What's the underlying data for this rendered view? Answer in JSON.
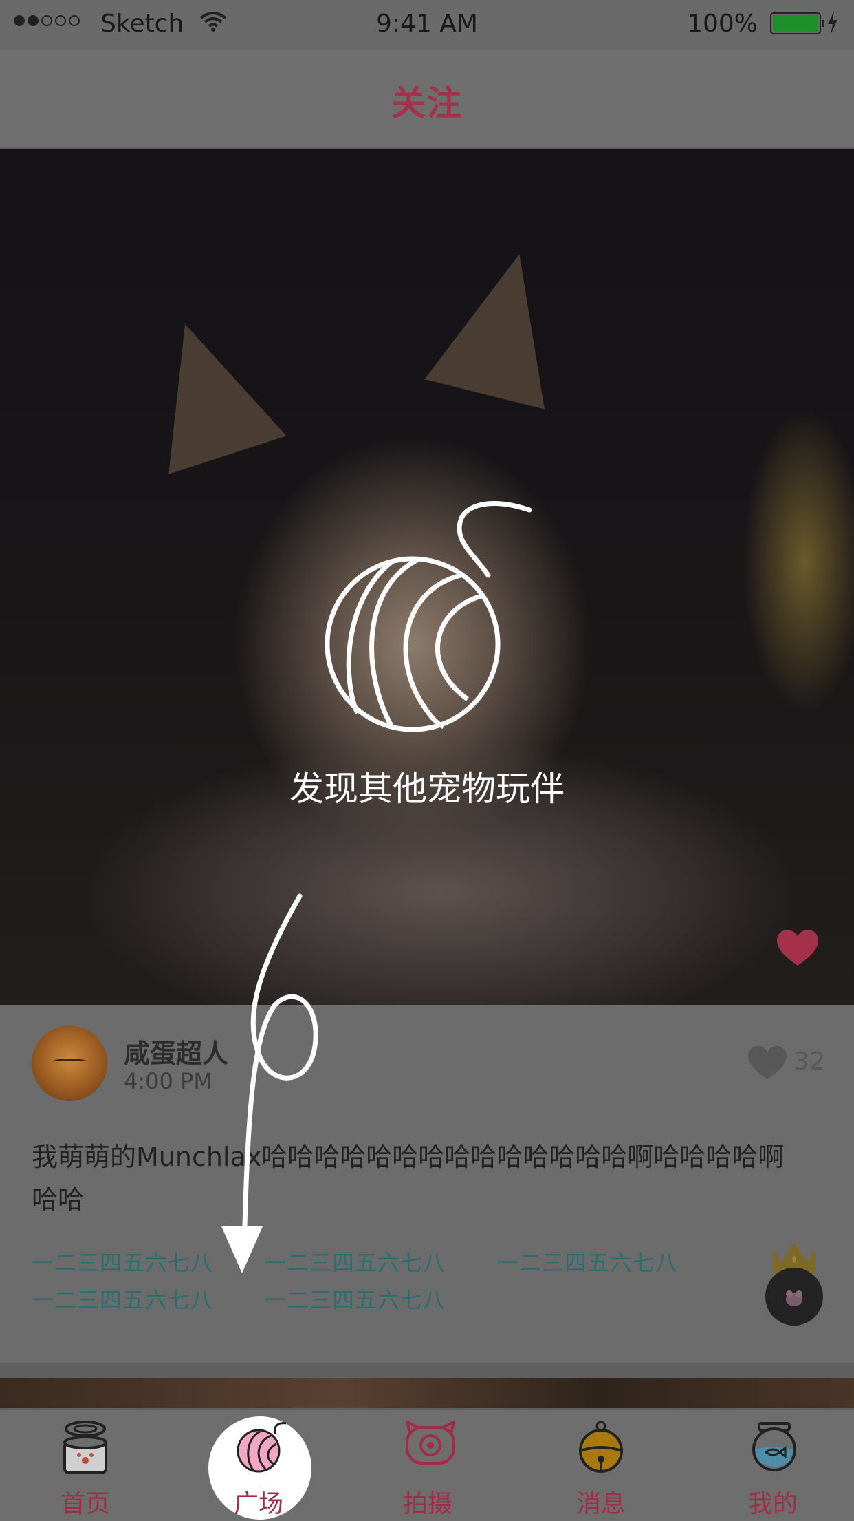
{
  "status_bar": {
    "carrier": "Sketch",
    "time": "9:41 AM",
    "battery": "100%",
    "icons": [
      "signal-dots",
      "wifi-icon",
      "battery-icon",
      "charging-icon"
    ]
  },
  "nav": {
    "title": "关注"
  },
  "hero": {
    "caption": "发现其他宠物玩伴",
    "icon": "yarn-ball-icon",
    "like_icon": "heart-icon"
  },
  "post": {
    "username": "咸蛋超人",
    "time": "4:00 PM",
    "like_count": "32",
    "text": "我萌萌的Munchlax哈哈哈哈哈哈哈哈哈哈哈哈哈哈啊哈哈哈哈啊哈哈",
    "tags": [
      "一二三四五六七八",
      "一二三四五六七八",
      "一二三四五六七八",
      "一二三四五六七八",
      "一二三四五六七八"
    ]
  },
  "tab_bar": {
    "tabs": [
      {
        "label": "首页",
        "icon": "pet-food-can-icon"
      },
      {
        "label": "广场",
        "icon": "yarn-ball-icon"
      },
      {
        "label": "拍摄",
        "icon": "pig-camera-icon"
      },
      {
        "label": "消息",
        "icon": "bell-icon"
      },
      {
        "label": "我的",
        "icon": "fishbowl-icon"
      }
    ],
    "active_tab": "广场"
  },
  "colors": {
    "accent": "#a4304a",
    "tag": "#2b6e71",
    "overlay": "#6a6a6a"
  }
}
